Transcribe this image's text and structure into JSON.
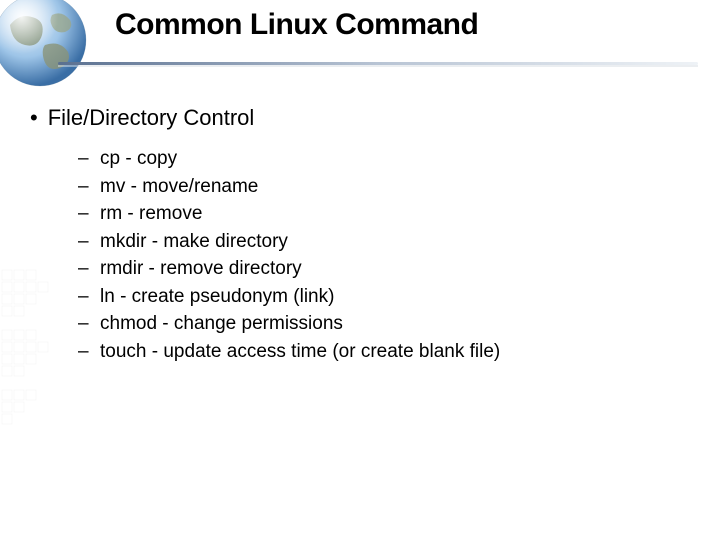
{
  "title": "Common Linux Command",
  "section": {
    "heading": "File/Directory Control",
    "items": [
      "cp - copy",
      "mv - move/rename",
      "rm - remove",
      "mkdir - make directory",
      "rmdir - remove directory",
      "ln - create pseudonym (link)",
      "chmod - change permissions",
      "touch - update access time (or create blank file)"
    ]
  }
}
